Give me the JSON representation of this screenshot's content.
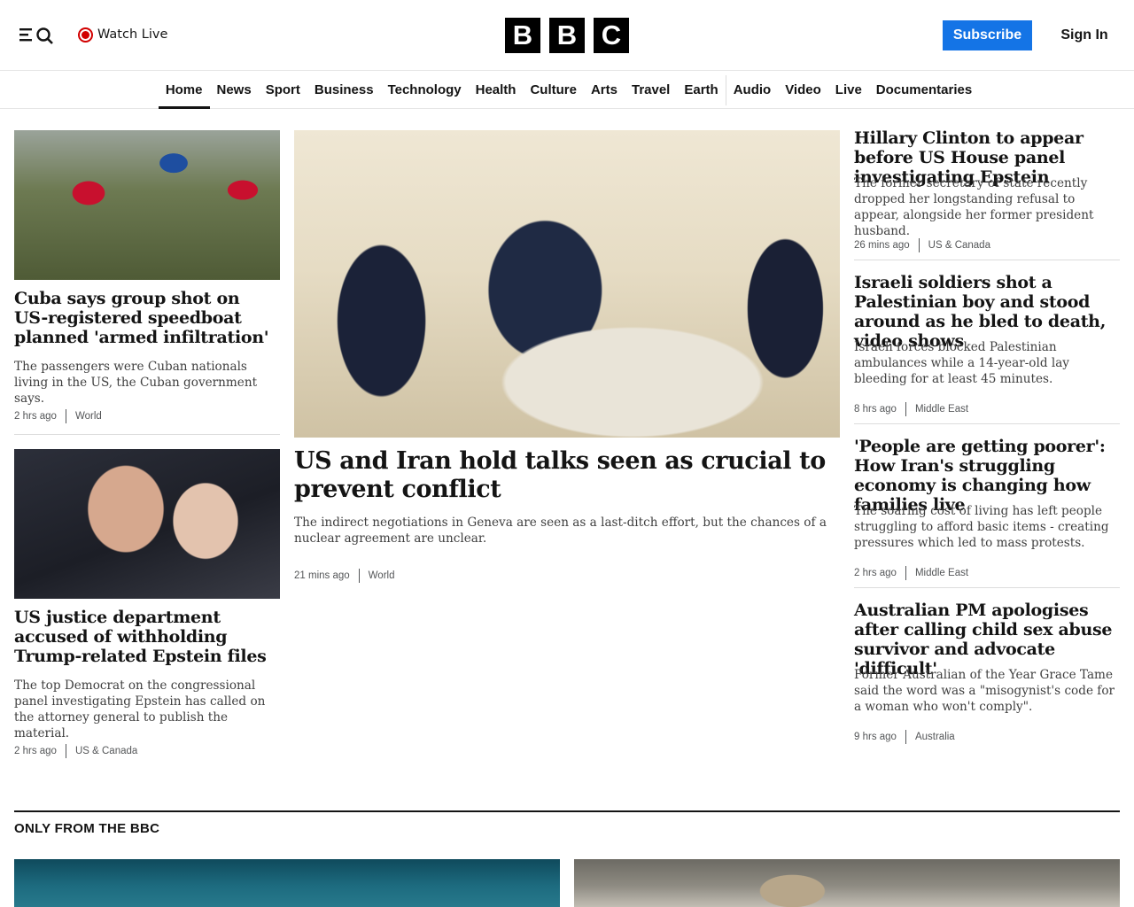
{
  "header": {
    "watch_live_label": "Watch Live",
    "logo_letters": [
      "B",
      "B",
      "C"
    ],
    "subscribe_label": "Subscribe",
    "sign_in_label": "Sign In"
  },
  "nav": {
    "items": [
      "Home",
      "News",
      "Sport",
      "Business",
      "Technology",
      "Health",
      "Culture",
      "Arts",
      "Travel",
      "Earth",
      "Audio",
      "Video",
      "Live",
      "Documentaries"
    ],
    "active": "Home"
  },
  "stories": {
    "cuba": {
      "headline": "Cuba says group shot on US-registered speedboat planned 'armed infiltration'",
      "summary": "The passengers were Cuban nationals living in the US, the Cuban government says.",
      "time": "2 hrs ago",
      "section": "World"
    },
    "epstein_files": {
      "headline": "US justice department accused of withholding Trump-related Epstein files",
      "summary": "The top Democrat on the congressional panel investigating Epstein has called on the attorney general to publish the material.",
      "time": "2 hrs ago",
      "section": "US & Canada"
    },
    "lead": {
      "headline": "US and Iran hold talks seen as crucial to prevent conflict",
      "summary": "The indirect negotiations in Geneva are seen as a last-ditch effort, but the chances of a nuclear agreement are unclear.",
      "time": "21 mins ago",
      "section": "World"
    },
    "clinton": {
      "headline": "Hillary Clinton to appear before US House panel investigating Epstein",
      "summary": "The former secretary of state recently dropped her longstanding refusal to appear, alongside her former president husband.",
      "time": "26 mins ago",
      "section": "US & Canada"
    },
    "israeli_soldiers": {
      "headline": "Israeli soldiers shot a Palestinian boy and stood around as he bled to death, video shows",
      "summary": "Israeli forces blocked Palestinian ambulances while a 14-year-old lay bleeding for at least 45 minutes.",
      "time": "8 hrs ago",
      "section": "Middle East"
    },
    "iran_economy": {
      "headline": "'People are getting poorer': How Iran's struggling economy is changing how families live",
      "summary": "The soaring cost of living has left people struggling to afford basic items - creating pressures which led to mass protests.",
      "time": "2 hrs ago",
      "section": "Middle East"
    },
    "australia": {
      "headline": "Australian PM apologises after calling child sex abuse survivor and advocate 'difficult'",
      "summary": "Former Australian of the Year Grace Tame said the word was a \"misogynist's code for a woman who won't comply\".",
      "time": "9 hrs ago",
      "section": "Australia"
    }
  },
  "only_from_bbc": {
    "title": "ONLY FROM THE BBC"
  }
}
